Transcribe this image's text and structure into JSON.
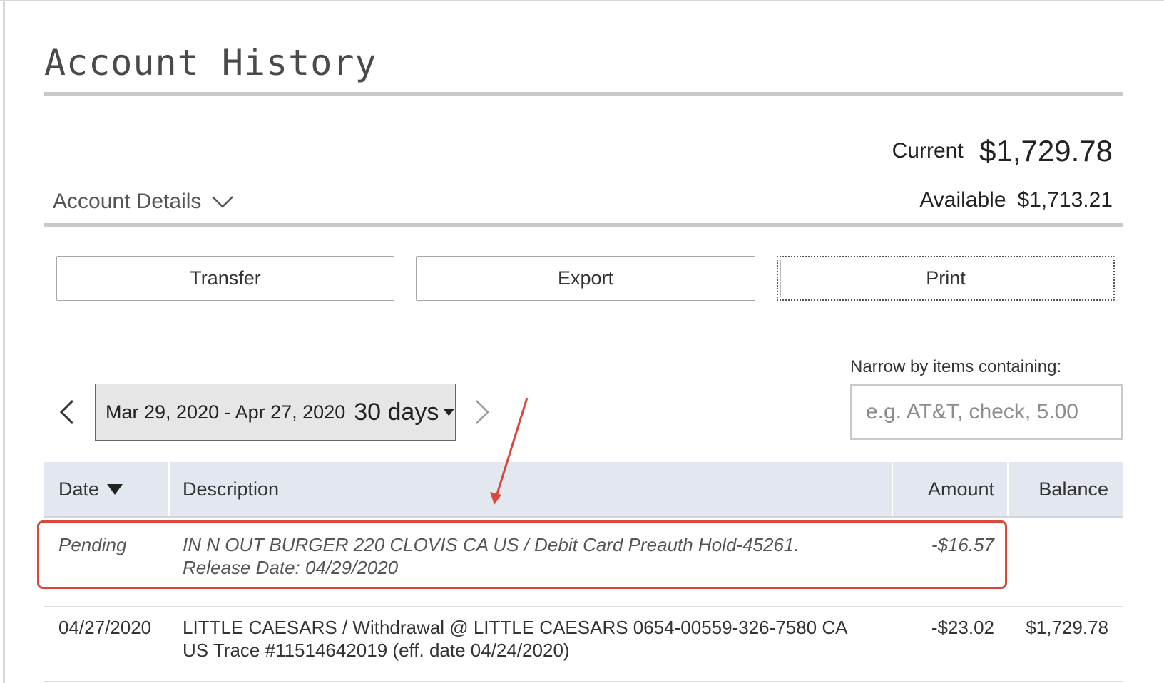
{
  "page": {
    "title": "Account History"
  },
  "summary": {
    "current_label": "Current",
    "current_value": "$1,729.78",
    "available_label": "Available",
    "available_value": "$1,713.21",
    "details_label": "Account Details"
  },
  "actions": {
    "transfer": "Transfer",
    "export": "Export",
    "print": "Print"
  },
  "filter": {
    "label": "Narrow by items containing:",
    "placeholder": "e.g. AT&T, check, 5.00",
    "value": ""
  },
  "date_range": {
    "range": "Mar 29, 2020 - Apr 27, 2020",
    "period": "30 days"
  },
  "table": {
    "headers": {
      "date": "Date",
      "description": "Description",
      "amount": "Amount",
      "balance": "Balance"
    },
    "rows": [
      {
        "date": "Pending",
        "description": "IN N OUT BURGER 220 CLOVIS CA US / Debit Card Preauth Hold-45261. Release Date: 04/29/2020",
        "amount": "-$16.57",
        "balance": ""
      },
      {
        "date": "04/27/2020",
        "description": "LITTLE CAESARS / Withdrawal @ LITTLE CAESARS 0654-00559-326-7580 CA US Trace #11514642019 (eff. date 04/24/2020)",
        "amount": "-$23.02",
        "balance": "$1,729.78"
      }
    ]
  },
  "icons": {
    "details_toggle": "chevron-down-icon",
    "prev": "chevron-left-icon",
    "next": "chevron-right-icon",
    "period_caret": "caret-down-icon",
    "sort": "sort-down-icon"
  },
  "annotation": {
    "color": "#d9483b"
  }
}
